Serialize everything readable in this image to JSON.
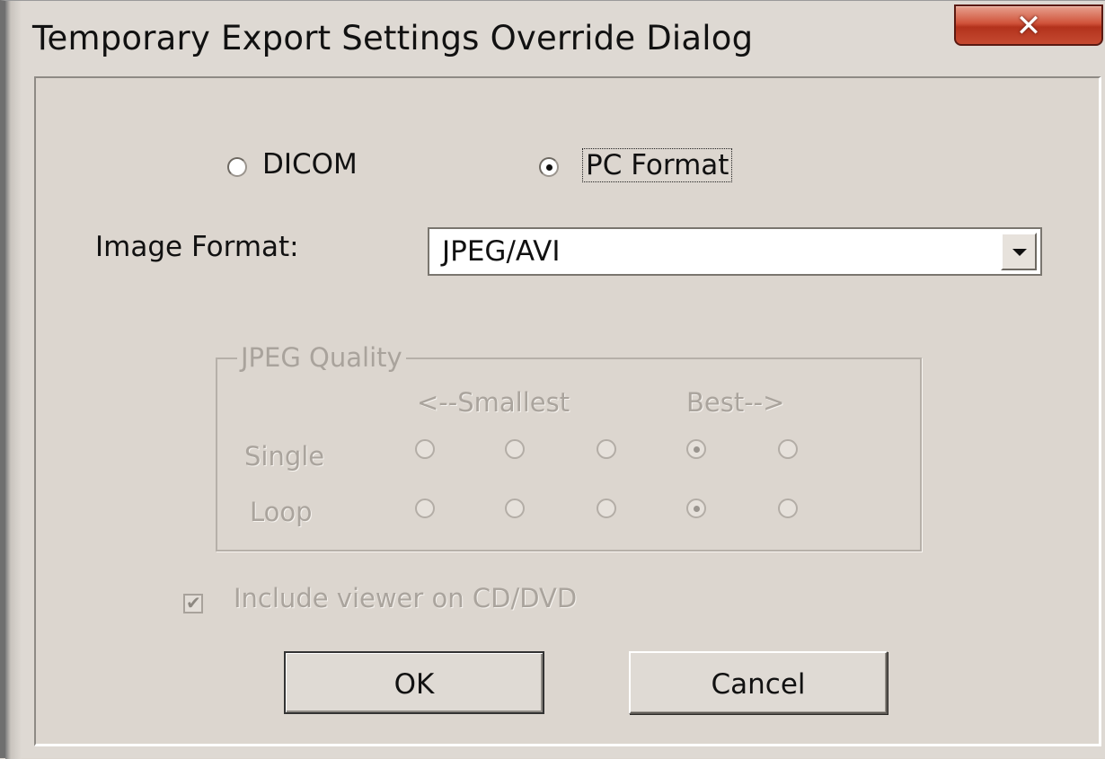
{
  "window": {
    "title": "Temporary Export Settings Override Dialog",
    "close_icon": "close-icon"
  },
  "format_choice": {
    "dicom_label": "DICOM",
    "dicom_selected": false,
    "pc_label": "PC Format",
    "pc_selected": true
  },
  "image_format": {
    "label": "Image Format:",
    "value": "JPEG/AVI"
  },
  "jpeg_quality": {
    "title": "JPEG Quality",
    "scale_smallest": "<--Smallest",
    "scale_best": "Best-->",
    "enabled": false,
    "rows": [
      {
        "label": "Single",
        "selected_index": 3,
        "options": 5
      },
      {
        "label": "Loop",
        "selected_index": 3,
        "options": 5
      }
    ]
  },
  "include_viewer": {
    "label": "Include viewer on CD/DVD",
    "checked": true,
    "enabled": false
  },
  "buttons": {
    "ok": "OK",
    "cancel": "Cancel"
  }
}
